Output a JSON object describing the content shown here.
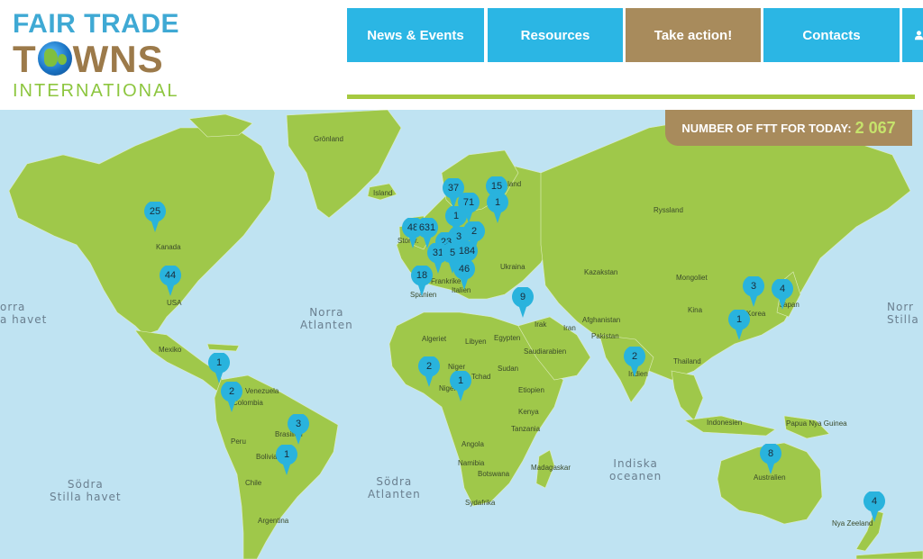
{
  "logo": {
    "line1": "FAIR TRADE",
    "line2a": "T",
    "line2b": "WNS",
    "line3": "INTERNATIONAL"
  },
  "nav": [
    {
      "label": "News & Events",
      "style": "blue"
    },
    {
      "label": "Resources",
      "style": "blue"
    },
    {
      "label": "Take action!",
      "style": "brown"
    },
    {
      "label": "Contacts",
      "style": "blue"
    }
  ],
  "colors": {
    "nav_blue": "#2bb6e4",
    "nav_brown": "#a88b5c",
    "ocean": "#bfe3f2",
    "land": "#9fc84a",
    "marker": "#29b3dd",
    "counter_value": "#c6e36b"
  },
  "counter": {
    "label": "NUMBER OF FTT FOR TODAY:",
    "value": "2 067"
  },
  "markers": [
    {
      "count": "25",
      "place": "Kanada"
    },
    {
      "count": "44",
      "place": "USA"
    },
    {
      "count": "1",
      "place": "Central America"
    },
    {
      "count": "2",
      "place": "Colombia"
    },
    {
      "count": "3",
      "place": "Brasilien"
    },
    {
      "count": "1",
      "place": "Bolivia"
    },
    {
      "count": "37",
      "place": "Norway"
    },
    {
      "count": "15",
      "place": "Finland"
    },
    {
      "count": "71",
      "place": "Sweden"
    },
    {
      "count": "1",
      "place": "Russia west"
    },
    {
      "count": "1",
      "place": "Denmark"
    },
    {
      "count": "48",
      "place": "Ireland"
    },
    {
      "count": "631",
      "place": "UK"
    },
    {
      "count": "2",
      "place": "Poland"
    },
    {
      "count": "3",
      "place": "Germany"
    },
    {
      "count": "23",
      "place": "Netherlands"
    },
    {
      "count": "31",
      "place": "France"
    },
    {
      "count": "5",
      "place": "Switzerland"
    },
    {
      "count": "184",
      "place": "Germany south"
    },
    {
      "count": "18",
      "place": "Spanien"
    },
    {
      "count": "46",
      "place": "Italien"
    },
    {
      "count": "9",
      "place": "Turkey"
    },
    {
      "count": "2",
      "place": "Niger"
    },
    {
      "count": "1",
      "place": "Nigeria"
    },
    {
      "count": "2",
      "place": "India"
    },
    {
      "count": "3",
      "place": "Korea"
    },
    {
      "count": "4",
      "place": "Japan"
    },
    {
      "count": "1",
      "place": "Taiwan"
    },
    {
      "count": "8",
      "place": "Australien"
    },
    {
      "count": "4",
      "place": "Nya Zeeland"
    }
  ],
  "country_labels": [
    "Grönland",
    "Island",
    "Kanada",
    "USA",
    "Mexiko",
    "Venezuela",
    "Colombia",
    "Peru",
    "Brasilien",
    "Bolivia",
    "Chile",
    "Argentina",
    "Storbr.",
    "Frankrike",
    "Spanien",
    "Italien",
    "Ukraina",
    "Finland",
    "Ryssland",
    "Kazakstan",
    "Mongoliet",
    "Kina",
    "Korea",
    "Japan",
    "Algeriet",
    "Libyen",
    "Egypten",
    "Niger",
    "Tchad",
    "Sudan",
    "Etiopien",
    "Nigeria",
    "Kenya",
    "Tanzania",
    "Angola",
    "Namibia",
    "Botswana",
    "Sydafrika",
    "Madagaskar",
    "Irak",
    "Iran",
    "Saudiarabien",
    "Afghanistan",
    "Pakistan",
    "Indien",
    "Thailand",
    "Indonesien",
    "Papua Nya Guinea",
    "Australien",
    "Nya Zeeland"
  ],
  "ocean_labels": {
    "north_pacific_left": "orra\na havet",
    "north_atlantic": "Norra\nAtlanten",
    "south_pacific": "Södra\nStilla havet",
    "south_atlantic": "Södra\nAtlanten",
    "indian": "Indiska\noceanen",
    "north_pacific_right": "Norr\nStilla"
  }
}
